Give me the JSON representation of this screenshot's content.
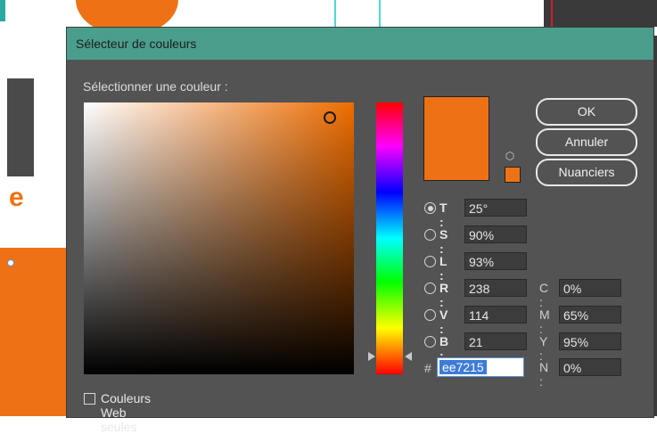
{
  "dialog": {
    "title": "Sélecteur de couleurs",
    "select_label": "Sélectionner une couleur :",
    "buttons": {
      "ok": "OK",
      "cancel": "Annuler",
      "swatches": "Nuanciers"
    },
    "hsb": [
      {
        "key": "T",
        "label": "T :",
        "value": "25°",
        "selected": true
      },
      {
        "key": "S",
        "label": "S :",
        "value": "90%",
        "selected": false
      },
      {
        "key": "L",
        "label": "L :",
        "value": "93%",
        "selected": false
      }
    ],
    "rgb": [
      {
        "key": "R",
        "label": "R :",
        "value": "238",
        "selected": false
      },
      {
        "key": "V",
        "label": "V :",
        "value": "114",
        "selected": false
      },
      {
        "key": "B",
        "label": "B :",
        "value": "21",
        "selected": false
      }
    ],
    "cmyk": [
      {
        "key": "C",
        "label": "C :",
        "value": "0%"
      },
      {
        "key": "M",
        "label": "M :",
        "value": "65%"
      },
      {
        "key": "Y",
        "label": "Y :",
        "value": "95%"
      },
      {
        "key": "N",
        "label": "N :",
        "value": "0%"
      }
    ],
    "hex": {
      "prefix": "#",
      "value": "ee7215"
    },
    "web_only_label": "Couleurs Web seules",
    "web_only_checked": false,
    "current_color": "#ee7215",
    "icons": {
      "gamut": "cube-icon",
      "checkbox": "checkbox-icon"
    }
  },
  "background": {
    "logo_letter": "e",
    "accent_color": "#ee7215",
    "dialog_title_color": "#4a9e8c"
  }
}
